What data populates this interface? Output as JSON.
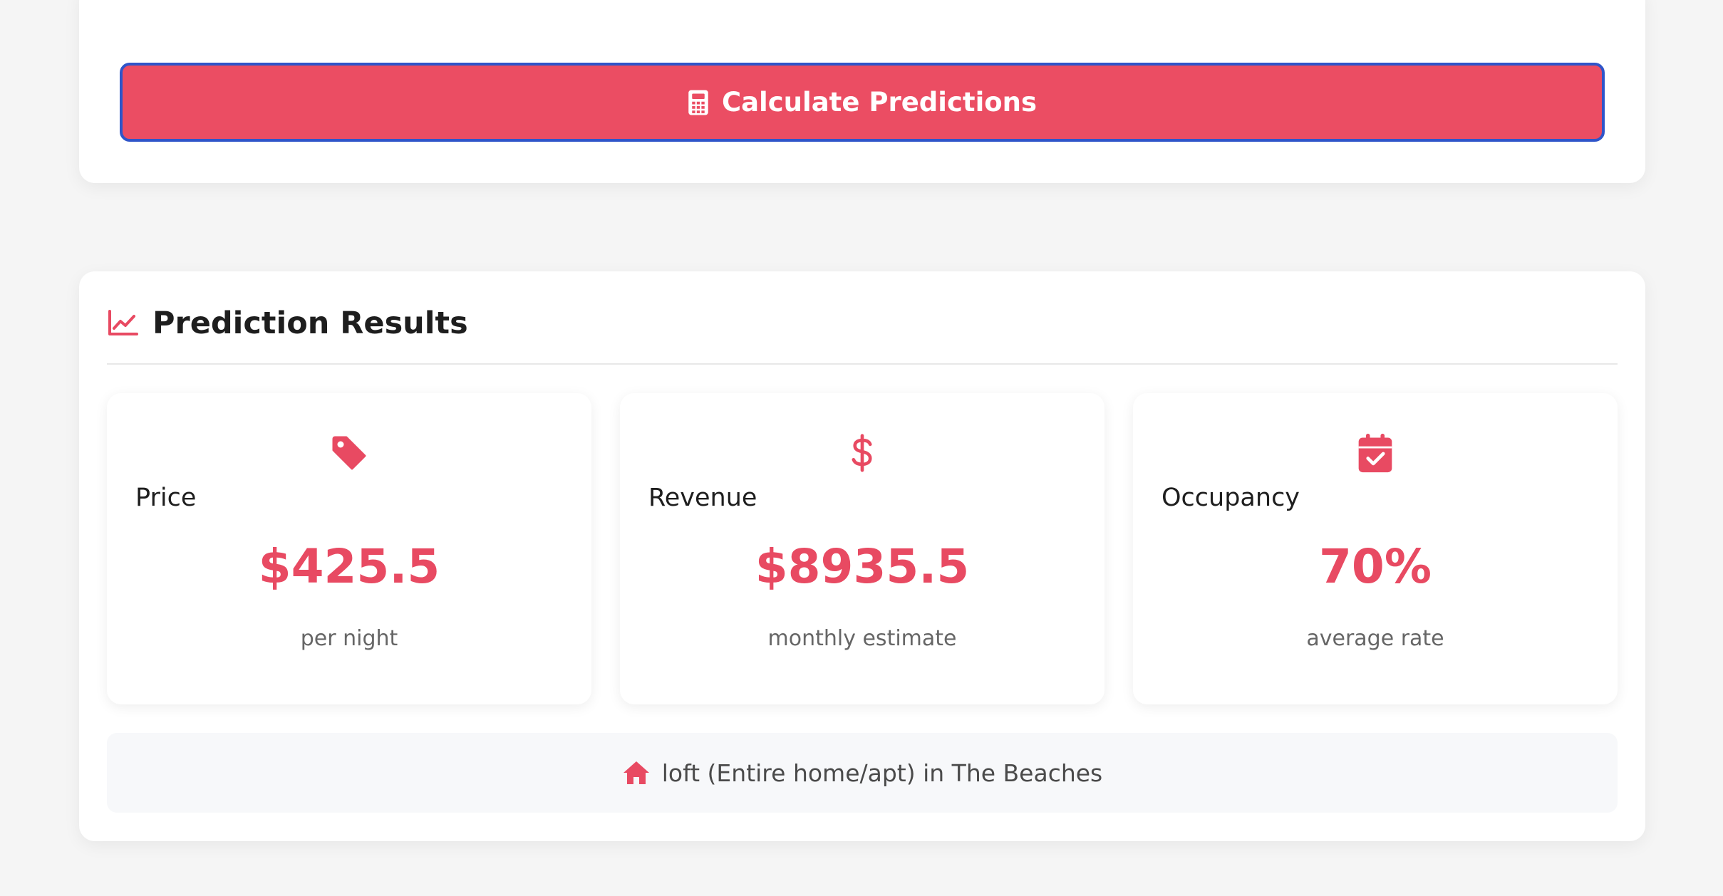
{
  "form": {
    "calculate_label": "Calculate Predictions",
    "calculate_icon": "calculator-icon"
  },
  "results": {
    "title": "Prediction Results",
    "title_icon": "chart-line-icon",
    "metrics": [
      {
        "icon": "tag-icon",
        "label": "Price",
        "value": "$425.5",
        "sub": "per night"
      },
      {
        "icon": "dollar-icon",
        "label": "Revenue",
        "value": "$8935.5",
        "sub": "monthly estimate"
      },
      {
        "icon": "calendar-check-icon",
        "label": "Occupancy",
        "value": "70%",
        "sub": "average rate"
      }
    ],
    "location": {
      "icon": "home-icon",
      "text": "loft (Entire home/apt) in The Beaches"
    }
  },
  "colors": {
    "accent": "#eb4d63",
    "button_border": "#2f55c9",
    "background": "#f5f5f5"
  }
}
